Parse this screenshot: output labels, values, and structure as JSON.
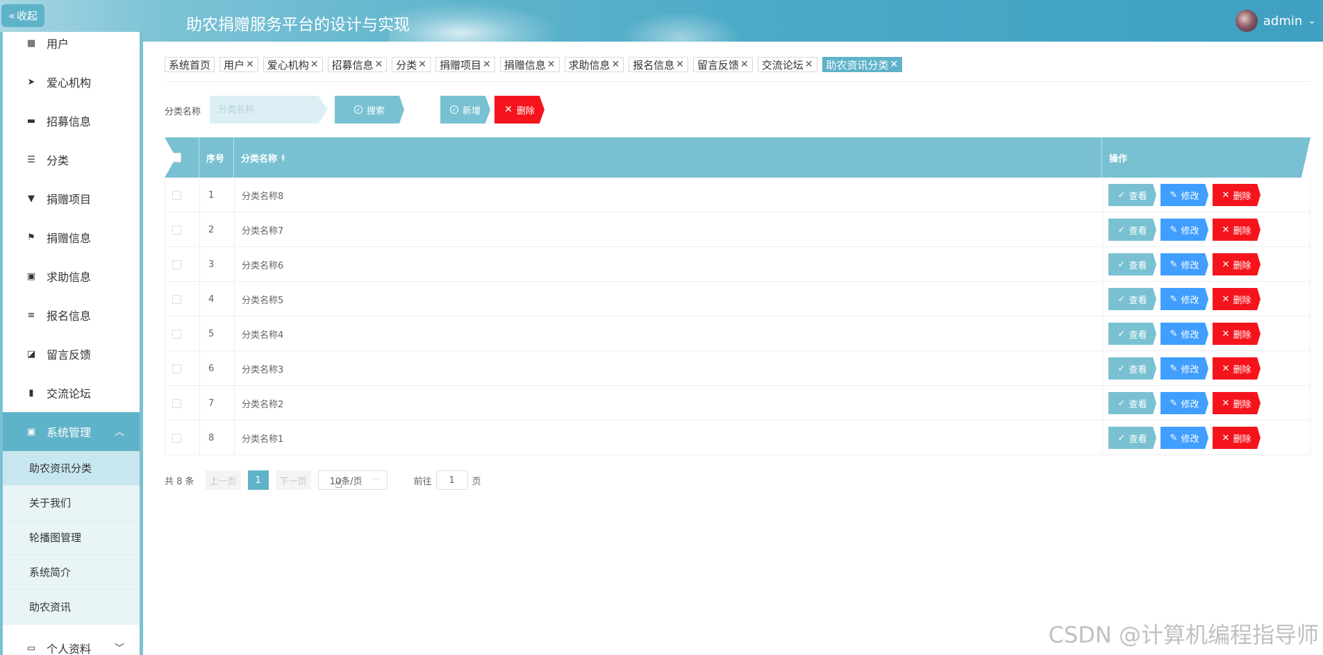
{
  "header": {
    "collapse_label": "收起",
    "title": "助农捐赠服务平台的设计与实现",
    "user_name": "admin"
  },
  "sidebar": {
    "items": [
      {
        "label": "用户",
        "icon": "grid-icon"
      },
      {
        "label": "爱心机构",
        "icon": "send-icon"
      },
      {
        "label": "招募信息",
        "icon": "printer-icon"
      },
      {
        "label": "分类",
        "icon": "sliders-icon"
      },
      {
        "label": "捐赠项目",
        "icon": "brush-icon"
      },
      {
        "label": "捐赠信息",
        "icon": "flag-icon"
      },
      {
        "label": "求助信息",
        "icon": "clipboard-icon"
      },
      {
        "label": "报名信息",
        "icon": "list-icon"
      },
      {
        "label": "留言反馈",
        "icon": "chart-line-icon"
      },
      {
        "label": "交流论坛",
        "icon": "bar-chart-icon"
      }
    ],
    "system": {
      "label": "系统管理",
      "sub_items": [
        "助农资讯分类",
        "关于我们",
        "轮播图管理",
        "系统简介",
        "助农资讯"
      ]
    },
    "profile": {
      "label": "个人资料"
    }
  },
  "tabs": [
    {
      "label": "系统首页",
      "closable": false
    },
    {
      "label": "用户",
      "closable": true
    },
    {
      "label": "爱心机构",
      "closable": true
    },
    {
      "label": "招募信息",
      "closable": true
    },
    {
      "label": "分类",
      "closable": true
    },
    {
      "label": "捐赠项目",
      "closable": true
    },
    {
      "label": "捐赠信息",
      "closable": true
    },
    {
      "label": "求助信息",
      "closable": true
    },
    {
      "label": "报名信息",
      "closable": true
    },
    {
      "label": "留言反馈",
      "closable": true
    },
    {
      "label": "交流论坛",
      "closable": true
    },
    {
      "label": "助农资讯分类",
      "closable": true,
      "active": true
    }
  ],
  "search": {
    "label": "分类名称",
    "placeholder": "分类名称",
    "search_btn": "搜索",
    "add_btn": "新增",
    "delete_btn": "删除"
  },
  "table": {
    "headers": {
      "index": "序号",
      "name": "分类名称",
      "actions": "操作"
    },
    "rows": [
      {
        "index": "1",
        "name": "分类名称8"
      },
      {
        "index": "2",
        "name": "分类名称7"
      },
      {
        "index": "3",
        "name": "分类名称6"
      },
      {
        "index": "4",
        "name": "分类名称5"
      },
      {
        "index": "5",
        "name": "分类名称4"
      },
      {
        "index": "6",
        "name": "分类名称3"
      },
      {
        "index": "7",
        "name": "分类名称2"
      },
      {
        "index": "8",
        "name": "分类名称1"
      }
    ],
    "row_actions": {
      "view": "查看",
      "edit": "修改",
      "delete": "删除"
    }
  },
  "pagination": {
    "total_text": "共 8 条",
    "prev": "上一页",
    "current_page": "1",
    "next": "下一页",
    "page_size": "10条/页",
    "goto_label": "前往",
    "goto_value": "1",
    "page_suffix": "页"
  },
  "watermark": "CSDN @计算机编程指导师",
  "colors": {
    "primary": "#5fb3c9",
    "header_row": "#79c1d2",
    "edit": "#409eff",
    "danger": "#f5141c"
  }
}
